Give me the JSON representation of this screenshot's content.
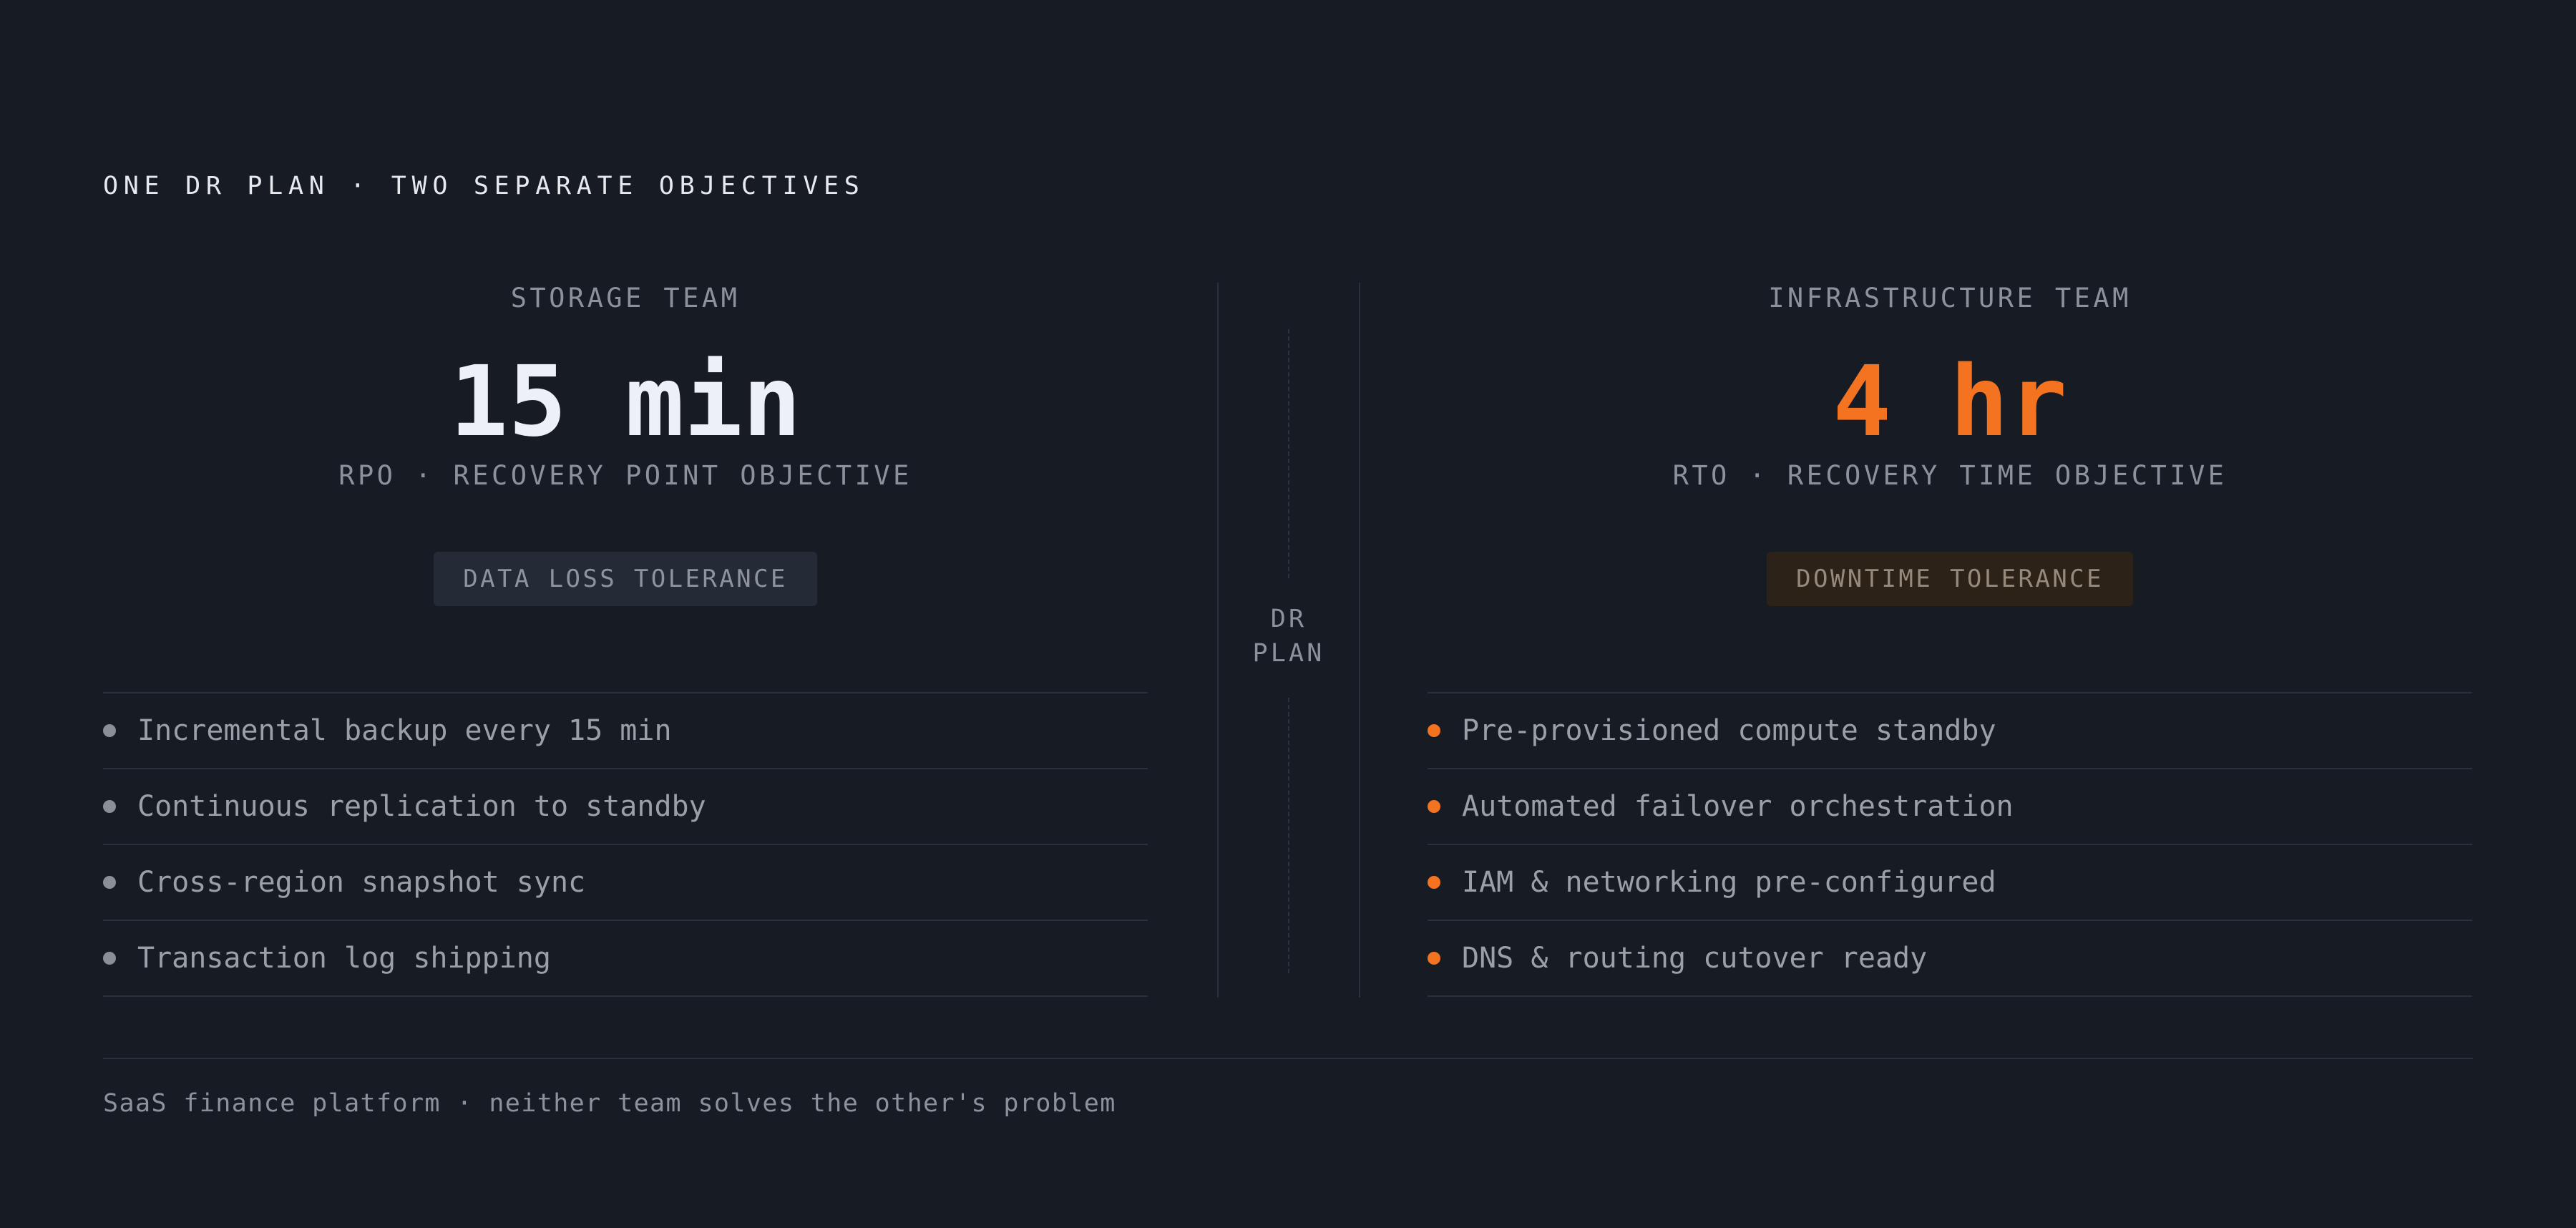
{
  "header": {
    "title": "ONE DR PLAN · TWO SEPARATE OBJECTIVES"
  },
  "storage": {
    "team": "STORAGE TEAM",
    "metric": "15 min",
    "objective": "RPO · RECOVERY POINT OBJECTIVE",
    "badge": "DATA LOSS TOLERANCE",
    "items": [
      "Incremental backup every 15 min",
      "Continuous replication to standby",
      "Cross-region snapshot sync",
      "Transaction log shipping"
    ]
  },
  "divider": {
    "line1": "DR",
    "line2": "PLAN"
  },
  "infrastructure": {
    "team": "INFRASTRUCTURE TEAM",
    "metric": "4 hr",
    "objective": "RTO · RECOVERY TIME OBJECTIVE",
    "badge": "DOWNTIME TOLERANCE",
    "items": [
      "Pre-provisioned compute standby",
      "Automated failover orchestration",
      "IAM & networking pre-configured",
      "DNS & routing cutover ready"
    ]
  },
  "footer": {
    "note": "SaaS finance platform · neither team solves the other's problem"
  },
  "colors": {
    "background": "#161b24",
    "accent": "#f47321",
    "text": "#e4e8ef",
    "muted": "#8c929c"
  }
}
